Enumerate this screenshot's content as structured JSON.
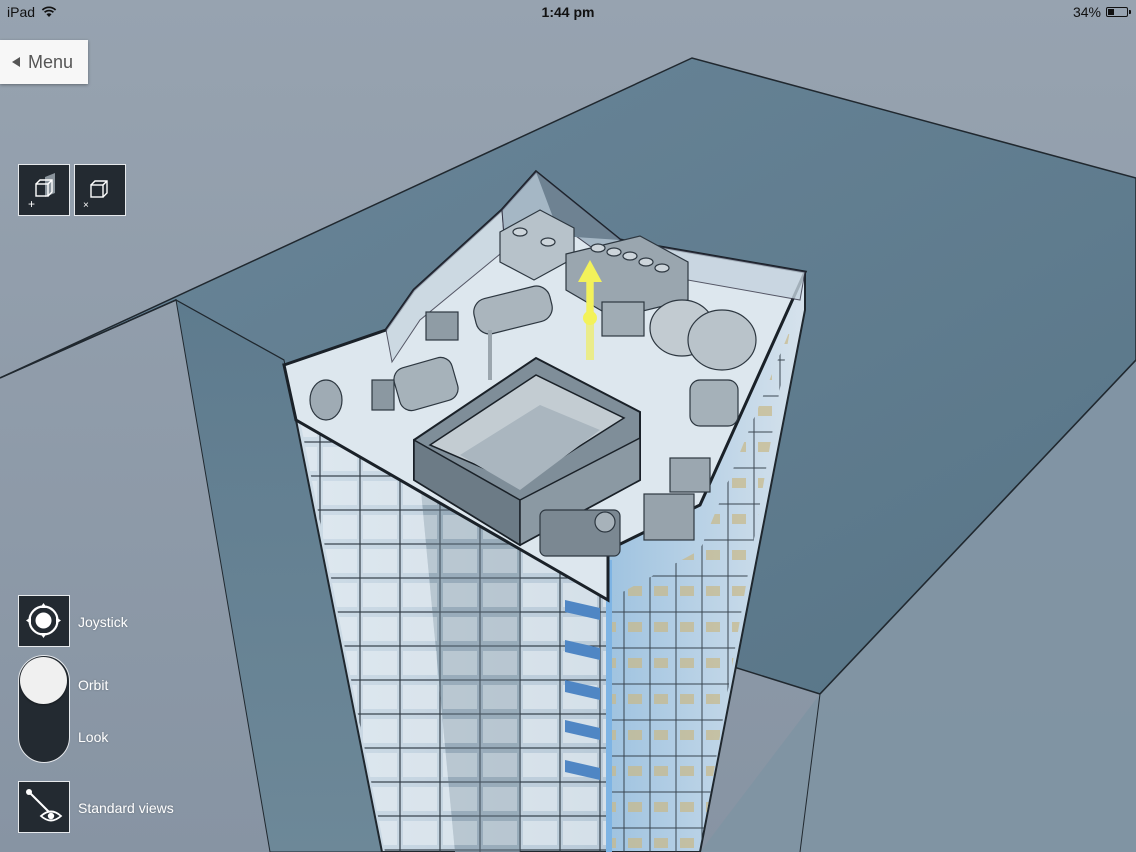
{
  "status_bar": {
    "device": "iPad",
    "time": "1:44 pm",
    "battery_text": "34%",
    "battery_level": 0.34
  },
  "menu": {
    "label": "Menu"
  },
  "tools": {
    "section_add_icon": "section-box-add-icon",
    "section_remove_icon": "section-box-remove-icon"
  },
  "navigation": {
    "joystick_label": "Joystick",
    "orbit_label": "Orbit",
    "look_label": "Look",
    "mode_selected": "Orbit",
    "standard_views_label": "Standard views"
  },
  "colors": {
    "sky": "#8e9ba9",
    "section_plane": "#5f7d91",
    "button_bg": "#232a31",
    "gizmo_yellow": "#f3f25a",
    "roof_floor": "#dbe5ec"
  }
}
